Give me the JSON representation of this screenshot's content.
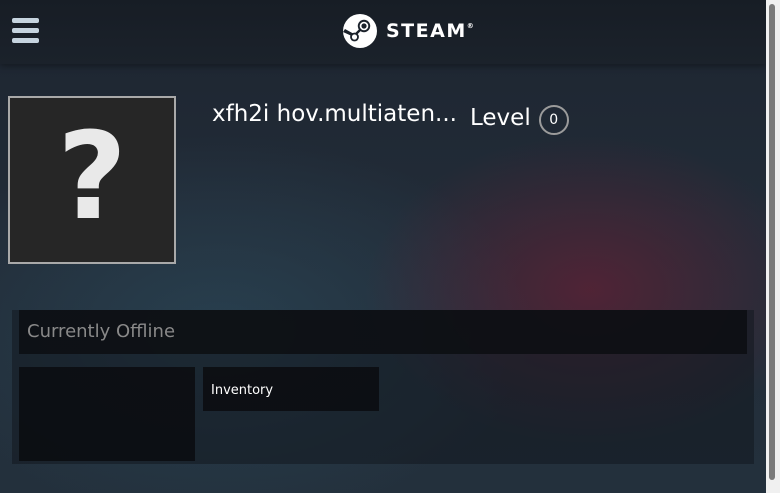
{
  "header": {
    "logo_text": "STEAM",
    "trademark": "®",
    "menu_icon": "hamburger-menu-icon"
  },
  "profile": {
    "persona_name": "xfh2i hov.multiaten...",
    "level_label": "Level",
    "level_value": "0",
    "avatar_placeholder": "?"
  },
  "status": {
    "text": "Currently Offline"
  },
  "items": {
    "inventory_label": "Inventory"
  }
}
